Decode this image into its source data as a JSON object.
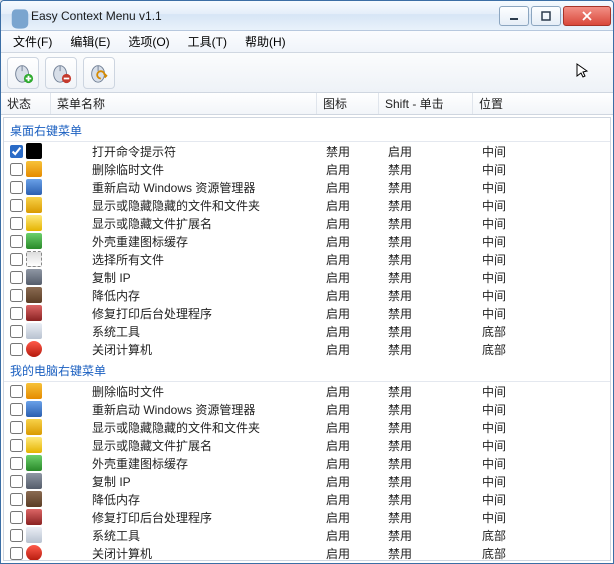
{
  "window": {
    "title": "Easy Context Menu v1.1"
  },
  "menubar": {
    "file": "文件(F)",
    "edit": "编辑(E)",
    "options": "选项(O)",
    "tools": "工具(T)",
    "help": "帮助(H)"
  },
  "columns": {
    "status": "状态",
    "name": "菜单名称",
    "icon": "图标",
    "shift": "Shift - 单击",
    "position": "位置"
  },
  "values": {
    "enabled": "启用",
    "disabled": "禁用",
    "middle": "中间",
    "bottom": "底部"
  },
  "groups": [
    {
      "title": "桌面右键菜单",
      "items": [
        {
          "checked": true,
          "icon": "ico-cmd",
          "label": "打开命令提示符",
          "iconState": "禁用",
          "shift": "启用",
          "position": "中间"
        },
        {
          "checked": false,
          "icon": "ico-del",
          "label": "删除临时文件",
          "iconState": "启用",
          "shift": "禁用",
          "position": "中间"
        },
        {
          "checked": false,
          "icon": "ico-restart",
          "label": "重新启动 Windows 资源管理器",
          "iconState": "启用",
          "shift": "禁用",
          "position": "中间"
        },
        {
          "checked": false,
          "icon": "ico-hidden",
          "label": "显示或隐藏隐藏的文件和文件夹",
          "iconState": "启用",
          "shift": "禁用",
          "position": "中间"
        },
        {
          "checked": false,
          "icon": "ico-ext",
          "label": "显示或隐藏文件扩展名",
          "iconState": "启用",
          "shift": "禁用",
          "position": "中间"
        },
        {
          "checked": false,
          "icon": "ico-shell",
          "label": "外壳重建图标缓存",
          "iconState": "启用",
          "shift": "禁用",
          "position": "中间"
        },
        {
          "checked": false,
          "icon": "ico-select",
          "label": "选择所有文件",
          "iconState": "启用",
          "shift": "禁用",
          "position": "中间"
        },
        {
          "checked": false,
          "icon": "ico-copyip",
          "label": "复制 IP",
          "iconState": "启用",
          "shift": "禁用",
          "position": "中间"
        },
        {
          "checked": false,
          "icon": "ico-ram",
          "label": "降低内存",
          "iconState": "启用",
          "shift": "禁用",
          "position": "中间"
        },
        {
          "checked": false,
          "icon": "ico-print",
          "label": "修复打印后台处理程序",
          "iconState": "启用",
          "shift": "禁用",
          "position": "中间"
        },
        {
          "checked": false,
          "icon": "ico-tools",
          "label": "系统工具",
          "iconState": "启用",
          "shift": "禁用",
          "position": "底部"
        },
        {
          "checked": false,
          "icon": "ico-off",
          "label": "关闭计算机",
          "iconState": "启用",
          "shift": "禁用",
          "position": "底部"
        }
      ]
    },
    {
      "title": "我的电脑右键菜单",
      "items": [
        {
          "checked": false,
          "icon": "ico-del",
          "label": "删除临时文件",
          "iconState": "启用",
          "shift": "禁用",
          "position": "中间"
        },
        {
          "checked": false,
          "icon": "ico-restart",
          "label": "重新启动 Windows 资源管理器",
          "iconState": "启用",
          "shift": "禁用",
          "position": "中间"
        },
        {
          "checked": false,
          "icon": "ico-hidden",
          "label": "显示或隐藏隐藏的文件和文件夹",
          "iconState": "启用",
          "shift": "禁用",
          "position": "中间"
        },
        {
          "checked": false,
          "icon": "ico-ext",
          "label": "显示或隐藏文件扩展名",
          "iconState": "启用",
          "shift": "禁用",
          "position": "中间"
        },
        {
          "checked": false,
          "icon": "ico-shell",
          "label": "外壳重建图标缓存",
          "iconState": "启用",
          "shift": "禁用",
          "position": "中间"
        },
        {
          "checked": false,
          "icon": "ico-copyip",
          "label": "复制 IP",
          "iconState": "启用",
          "shift": "禁用",
          "position": "中间"
        },
        {
          "checked": false,
          "icon": "ico-ram",
          "label": "降低内存",
          "iconState": "启用",
          "shift": "禁用",
          "position": "中间"
        },
        {
          "checked": false,
          "icon": "ico-print",
          "label": "修复打印后台处理程序",
          "iconState": "启用",
          "shift": "禁用",
          "position": "中间"
        },
        {
          "checked": false,
          "icon": "ico-tools",
          "label": "系统工具",
          "iconState": "启用",
          "shift": "禁用",
          "position": "底部"
        },
        {
          "checked": false,
          "icon": "ico-off",
          "label": "关闭计算机",
          "iconState": "启用",
          "shift": "禁用",
          "position": "底部"
        }
      ]
    }
  ]
}
